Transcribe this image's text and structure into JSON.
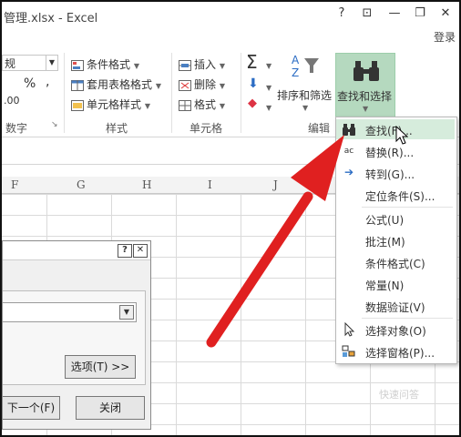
{
  "window": {
    "title": "管理.xlsx - Excel",
    "help": "?",
    "restore_ribbon": "⊡",
    "minimize": "—",
    "maximize": "❐",
    "close": "✕",
    "signin": "登录"
  },
  "ribbon": {
    "number_format": "规",
    "percent": "%",
    "comma": ",",
    "decimals": ".00",
    "group_number": "数字",
    "style": {
      "conditional": "条件格式",
      "table": "套用表格格式",
      "cell_style": "单元格样式",
      "group": "样式"
    },
    "cells": {
      "insert": "插入",
      "delete": "删除",
      "format": "格式",
      "group": "单元格"
    },
    "editing": {
      "sigma": "Σ",
      "sort_filter": "排序和筛选",
      "find_select": "查找和选择",
      "group": "编辑"
    }
  },
  "columns": [
    "F",
    "G",
    "H",
    "I",
    "J"
  ],
  "dropdown_menu": [
    {
      "icon": "binoculars-icon",
      "label": "查找(F)..."
    },
    {
      "icon": "replace-icon",
      "label": "替换(R)..."
    },
    {
      "icon": "goto-arrow-icon",
      "label": "转到(G)..."
    },
    {
      "icon": "none",
      "label": "定位条件(S)..."
    },
    {
      "icon": "none",
      "label": "公式(U)"
    },
    {
      "icon": "none",
      "label": "批注(M)"
    },
    {
      "icon": "none",
      "label": "条件格式(C)"
    },
    {
      "icon": "none",
      "label": "常量(N)"
    },
    {
      "icon": "none",
      "label": "数据验证(V)"
    },
    {
      "icon": "select-objects-icon",
      "label": "选择对象(O)"
    },
    {
      "icon": "selection-pane-icon",
      "label": "选择窗格(P)..."
    }
  ],
  "dialog": {
    "help_btn": "?",
    "close_btn": "✕",
    "options_btn": "选项(T) >>",
    "find_next_btn": "下一个(F)",
    "close_label": "关闭"
  },
  "watermark": "快速问答",
  "colors": {
    "highlight": "#d6ecdc",
    "find_button": "#b5d9bf",
    "arrow": "#e02020"
  }
}
